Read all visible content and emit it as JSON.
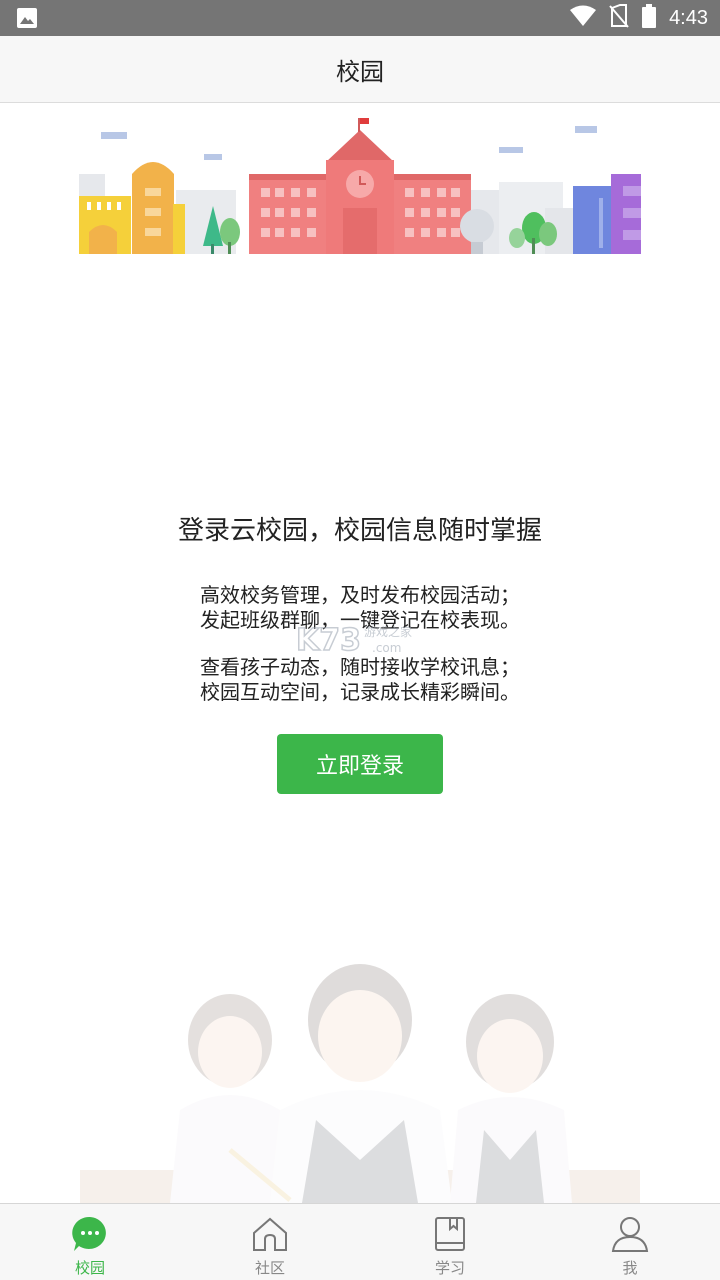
{
  "status_bar": {
    "time": "4:43",
    "icons": [
      "image-icon",
      "wifi-icon",
      "no-sim-icon",
      "battery-icon"
    ]
  },
  "header": {
    "title": "校园"
  },
  "main": {
    "headline": "登录云校园，校园信息随时掌握",
    "description_1": [
      "高效校务管理，及时发布校园活动；",
      "发起班级群聊，一键登记在校表现。"
    ],
    "description_2": [
      "查看孩子动态，随时接收学校讯息；",
      "校园互动空间，记录成长精彩瞬间。"
    ],
    "login_button": "立即登录",
    "watermark": {
      "brand": "K73",
      "cn": "游戏之家",
      "domain": ".com"
    }
  },
  "tabs": [
    {
      "label": "校园",
      "icon": "chat-bubble-icon",
      "active": true
    },
    {
      "label": "社区",
      "icon": "home-icon",
      "active": false
    },
    {
      "label": "学习",
      "icon": "book-icon",
      "active": false
    },
    {
      "label": "我",
      "icon": "user-icon",
      "active": false
    }
  ],
  "colors": {
    "accent": "#3cb64a",
    "status_bar": "#757575",
    "tab_inactive": "#888888"
  }
}
